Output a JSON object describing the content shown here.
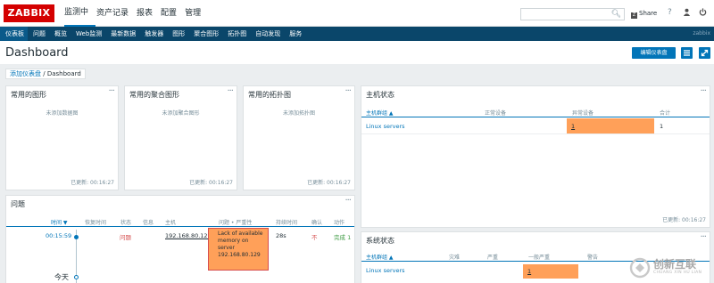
{
  "header": {
    "logo": "ZABBIX",
    "nav": [
      "监测中",
      "资产记录",
      "报表",
      "配置",
      "管理"
    ],
    "share_label": "Share",
    "help_icon": "?",
    "user_icon": "user-icon",
    "power_icon": "power-icon"
  },
  "subnav": {
    "items": [
      "仪表板",
      "问题",
      "概览",
      "Web监测",
      "最新数据",
      "触发器",
      "图形",
      "聚合图形",
      "拓扑图",
      "自动发现",
      "服务"
    ],
    "brand": "zabbix"
  },
  "page": {
    "title": "Dashboard",
    "edit_button": "编辑仪表盘",
    "breadcrumb": {
      "first": "添加仪表盘",
      "sep": "/",
      "current": "Dashboard"
    }
  },
  "widgets": {
    "favorite_graphs": {
      "title": "常用的图形",
      "empty": "未添加数据图",
      "updated": "已更新: 00:16:27",
      "dots": "···"
    },
    "favorite_screens": {
      "title": "常用的聚合图形",
      "empty": "未添加聚合图形",
      "updated": "已更新: 00:16:27",
      "dots": "···"
    },
    "favorite_maps": {
      "title": "常用的拓扑图",
      "empty": "未添加拓扑图",
      "updated": "已更新: 00:16:27",
      "dots": "···"
    },
    "host_status": {
      "title": "主机状态",
      "dots": "···",
      "columns": [
        "主机群组 ▲",
        "正常设备",
        "异常设备",
        "合计"
      ],
      "row": {
        "group": "Linux servers",
        "ok": "",
        "problem": "1",
        "total": "1"
      },
      "updated": "已更新: 00:16:27"
    },
    "problems": {
      "title": "问题",
      "dots": "···",
      "columns": [
        "时间 ▼",
        "恢复时间",
        "状态",
        "信息",
        "主机",
        "问题 • 严重性",
        "持续时间",
        "确认",
        "动作"
      ],
      "row": {
        "time": "00:15:59",
        "status": "问题",
        "host": "192.168.80.129",
        "problem_lines": [
          "Lack of available",
          "memory on",
          "server",
          "192.168.80.129"
        ],
        "duration": "28s",
        "ack": "不",
        "action": "完成 1"
      },
      "today": "今天"
    },
    "system_status": {
      "title": "系统状态",
      "dots": "···",
      "columns": [
        "主机群组 ▲",
        "灾难",
        "严重",
        "一般严重",
        "警告"
      ],
      "row": {
        "group": "Linux servers",
        "average": "1"
      }
    }
  },
  "watermark": {
    "text": "创新互联",
    "sub": "CHUANG XIN HU LIAN"
  },
  "colors": {
    "accent": "#0275b8",
    "navbar": "#0a466a",
    "logo": "#d40000",
    "warning": "#ffa059",
    "problem": "#d64e4e"
  }
}
